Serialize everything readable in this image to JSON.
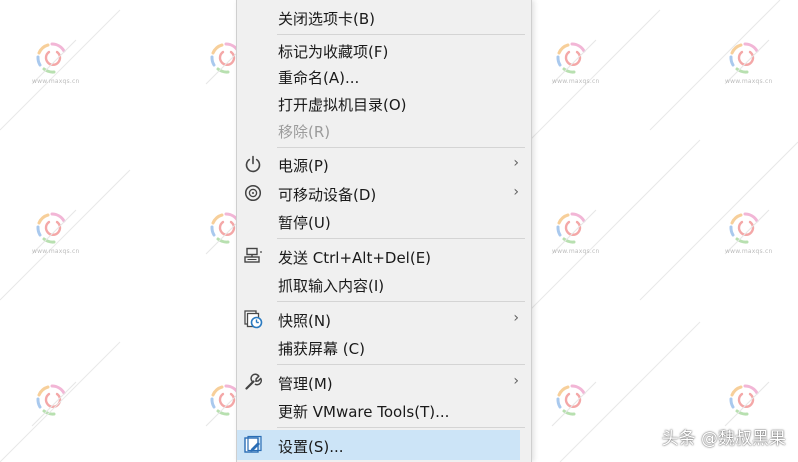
{
  "context_menu": {
    "items": [
      {
        "label": "关闭选项卡(B)",
        "icon": null,
        "submenu": false,
        "disabled": false
      },
      {
        "label": "标记为收藏项(F)",
        "icon": null,
        "submenu": false,
        "disabled": false
      },
      {
        "label": "重命名(A)...",
        "icon": null,
        "submenu": false,
        "disabled": false
      },
      {
        "label": "打开虚拟机目录(O)",
        "icon": null,
        "submenu": false,
        "disabled": false
      },
      {
        "label": "移除(R)",
        "icon": null,
        "submenu": false,
        "disabled": true
      },
      {
        "label": "电源(P)",
        "icon": "power-icon",
        "submenu": true,
        "disabled": false
      },
      {
        "label": "可移动设备(D)",
        "icon": "removable-device-icon",
        "submenu": true,
        "disabled": false
      },
      {
        "label": "暂停(U)",
        "icon": null,
        "submenu": false,
        "disabled": false
      },
      {
        "label": "发送 Ctrl+Alt+Del(E)",
        "icon": "send-keys-icon",
        "submenu": false,
        "disabled": false
      },
      {
        "label": "抓取输入内容(I)",
        "icon": null,
        "submenu": false,
        "disabled": false
      },
      {
        "label": "快照(N)",
        "icon": "snapshot-icon",
        "submenu": true,
        "disabled": false
      },
      {
        "label": "捕获屏幕 (C)",
        "icon": null,
        "submenu": false,
        "disabled": false
      },
      {
        "label": "管理(M)",
        "icon": "wrench-icon",
        "submenu": true,
        "disabled": false
      },
      {
        "label": "更新 VMware Tools(T)...",
        "icon": null,
        "submenu": false,
        "disabled": false
      },
      {
        "label": "设置(S)...",
        "icon": "settings-icon",
        "submenu": false,
        "disabled": false,
        "highlighted": true
      }
    ],
    "submenu_arrow": "›",
    "highlight_color": "#cce4f7"
  },
  "watermark": {
    "text": "www.maxqs.cn"
  },
  "credit": {
    "text": "头条 @魏叔黑果"
  }
}
